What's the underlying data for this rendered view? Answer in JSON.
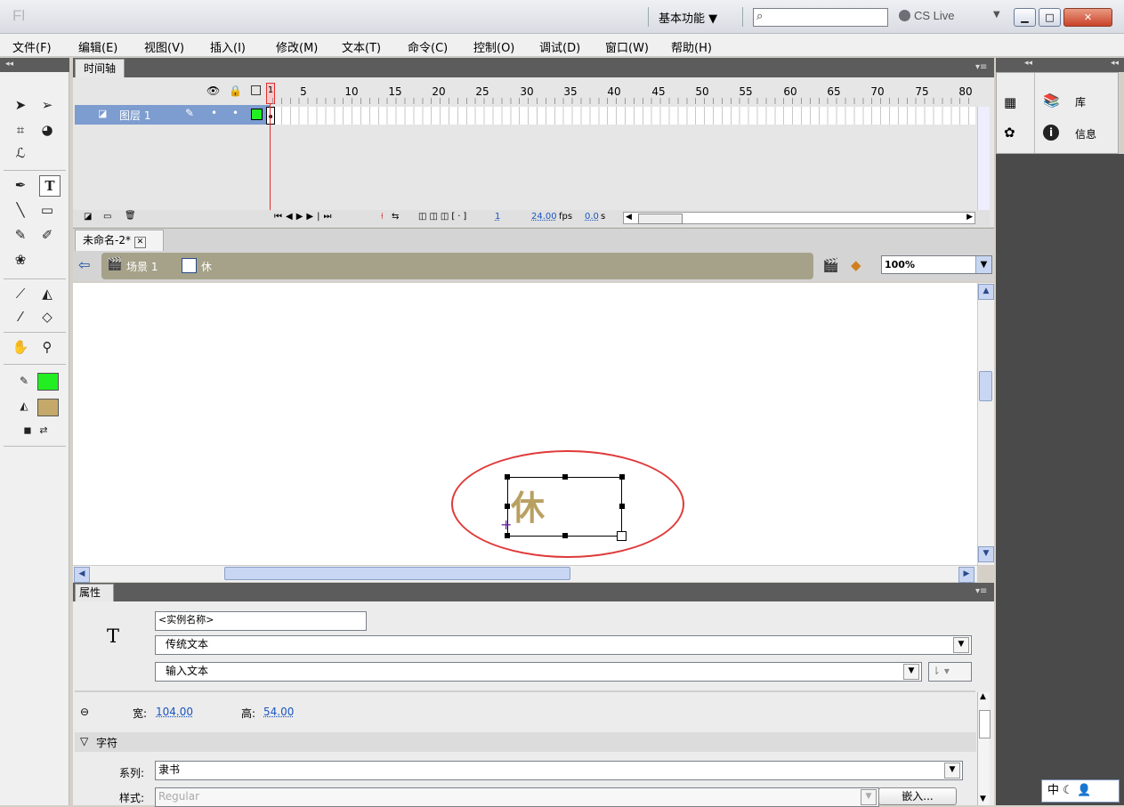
{
  "app": {
    "logo": "Fl",
    "workspace": "基本功能",
    "cs_live": "CS Live"
  },
  "menubar": [
    "文件(F)",
    "编辑(E)",
    "视图(V)",
    "插入(I)",
    "修改(M)",
    "文本(T)",
    "命令(C)",
    "控制(O)",
    "调试(D)",
    "窗口(W)",
    "帮助(H)"
  ],
  "timeline": {
    "tab": "时间轴",
    "frame_numbers": [
      "1",
      "5",
      "10",
      "15",
      "20",
      "25",
      "30",
      "35",
      "40",
      "45",
      "50",
      "55",
      "60",
      "65",
      "70",
      "75",
      "80"
    ],
    "layer_name": "图层 1",
    "current_frame": "1",
    "fps": "24.00",
    "fps_unit": "fps",
    "time": "0.0",
    "time_unit": "s"
  },
  "document": {
    "tab": "未命名-2*",
    "scene": "场景 1",
    "symbol": "休",
    "zoom": "100%"
  },
  "stage": {
    "text": "休"
  },
  "properties": {
    "tab": "属性",
    "instance_name_placeholder": "<实例名称>",
    "text_engine": "传统文本",
    "text_type": "输入文本",
    "width_label": "宽:",
    "width": "104.00",
    "height_label": "高:",
    "height": "54.00",
    "section_character": "字符",
    "family_label": "系列:",
    "family": "隶书",
    "style_label": "样式:",
    "style": "Regular",
    "embed_button": "嵌入..."
  },
  "right_panel": {
    "library": "库",
    "info": "信息"
  },
  "ime": {
    "mode": "中"
  },
  "colors": {
    "stroke": "#22ee22",
    "fill": "#c4a96a",
    "layer_highlight": "#7d9ccf",
    "playhead": "#e03030"
  },
  "icons": [
    "search-icon",
    "selection-tool-icon",
    "text-tool-icon",
    "hand-icon",
    "zoom-icon",
    "library-icon",
    "info-icon",
    "eye-icon",
    "lock-icon"
  ]
}
